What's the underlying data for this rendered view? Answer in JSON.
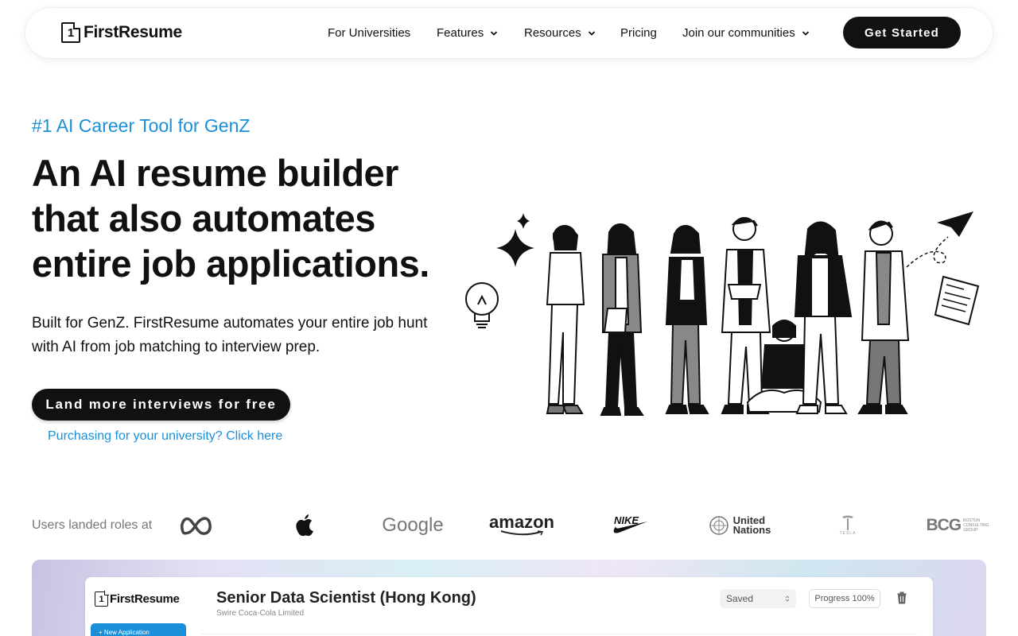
{
  "nav": {
    "logo_digit": "1",
    "logo_text": "FirstResume",
    "links": [
      {
        "label": "For Universities",
        "dropdown": false
      },
      {
        "label": "Features",
        "dropdown": true
      },
      {
        "label": "Resources",
        "dropdown": true
      },
      {
        "label": "Pricing",
        "dropdown": false
      },
      {
        "label": "Join our communities",
        "dropdown": true
      }
    ],
    "cta_label": "Get Started"
  },
  "hero": {
    "tagline": "#1 AI Career Tool for GenZ",
    "headline": "An AI resume builder that also automates entire job applications.",
    "subtext": "Built for GenZ. FirstResume automates your entire job hunt with AI from job matching to interview prep.",
    "cta_label": "Land more interviews for free",
    "university_link": "Purchasing for your university? Click here",
    "illustration": "group-of-young-professionals-icon"
  },
  "logos": {
    "label": "Users landed roles at",
    "brands": [
      {
        "name": "Meta",
        "icon": "meta-logo-icon"
      },
      {
        "name": "Apple",
        "icon": "apple-logo-icon"
      },
      {
        "name": "Google",
        "text": "Google"
      },
      {
        "name": "Amazon",
        "text": "amazon"
      },
      {
        "name": "Nike",
        "text": "NIKE"
      },
      {
        "name": "United Nations",
        "text_line1": "United",
        "text_line2": "Nations"
      },
      {
        "name": "Tesla",
        "text": "TESLA"
      },
      {
        "name": "BCG",
        "text": "BCG",
        "sub": [
          "BOSTON",
          "CONSULTING",
          "GROUP"
        ]
      }
    ]
  },
  "preview": {
    "logo_digit": "1",
    "logo_text": "FirstResume",
    "new_application": "+ New Application",
    "job_title": "Senior Data Scientist (Hong Kong)",
    "company": "Swire Coca-Cola Limited",
    "status": "Saved",
    "progress": "Progress 100%",
    "progress_value": 100
  },
  "colors": {
    "accent": "#1a8fd8",
    "button": "#111111"
  }
}
